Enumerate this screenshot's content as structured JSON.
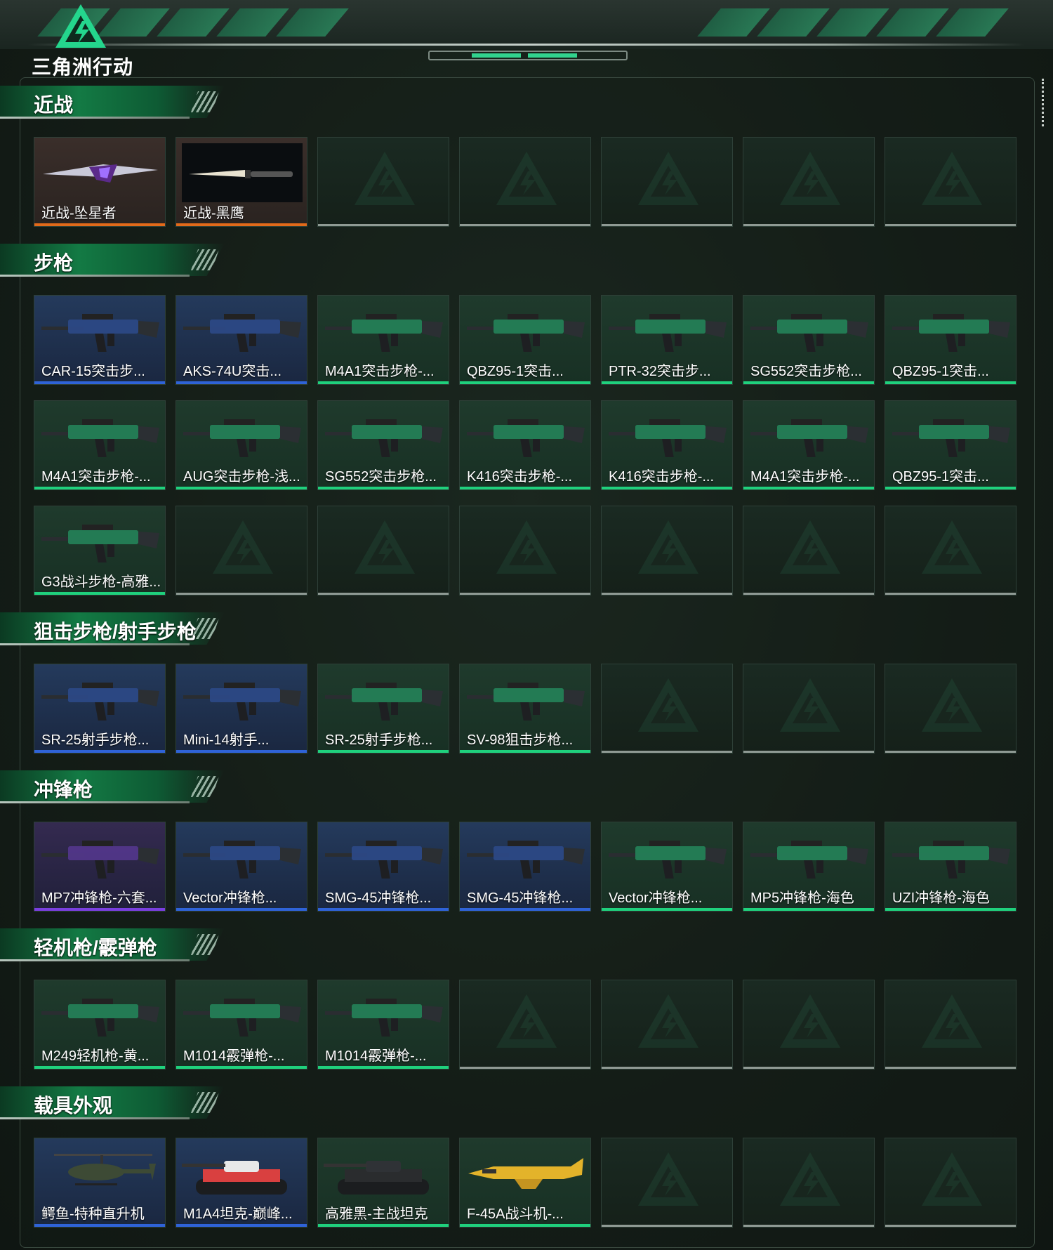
{
  "brand": {
    "name": "三角洲行动"
  },
  "colors": {
    "blue": "#2f63d8",
    "purple": "#7a3fe0",
    "orange": "#e26a1a",
    "green": "#1fd17d",
    "empty": "#8f9a94"
  },
  "sections": [
    {
      "title": "近战",
      "rows": 1,
      "items": [
        {
          "name": "近战-坠星者",
          "rarity": "orange",
          "icon": "blade-icon"
        },
        {
          "name": "近战-黑鹰",
          "rarity": "orange",
          "icon": "knife-icon"
        }
      ]
    },
    {
      "title": "步枪",
      "rows": 3,
      "items": [
        {
          "name": "CAR-15突击步...",
          "rarity": "blue",
          "icon": "rifle-icon"
        },
        {
          "name": "AKS-74U突击...",
          "rarity": "blue",
          "icon": "rifle-icon"
        },
        {
          "name": "M4A1突击步枪-...",
          "rarity": "green",
          "icon": "rifle-icon"
        },
        {
          "name": "QBZ95-1突击...",
          "rarity": "green",
          "icon": "rifle-icon"
        },
        {
          "name": "PTR-32突击步...",
          "rarity": "green",
          "icon": "rifle-icon"
        },
        {
          "name": "SG552突击步枪...",
          "rarity": "green",
          "icon": "rifle-icon"
        },
        {
          "name": "QBZ95-1突击...",
          "rarity": "green",
          "icon": "rifle-icon"
        },
        {
          "name": "M4A1突击步枪-...",
          "rarity": "green",
          "icon": "rifle-icon"
        },
        {
          "name": "AUG突击步枪-浅...",
          "rarity": "green",
          "icon": "rifle-icon"
        },
        {
          "name": "SG552突击步枪...",
          "rarity": "green",
          "icon": "rifle-icon"
        },
        {
          "name": "K416突击步枪-...",
          "rarity": "green",
          "icon": "rifle-icon"
        },
        {
          "name": "K416突击步枪-...",
          "rarity": "green",
          "icon": "rifle-icon"
        },
        {
          "name": "M4A1突击步枪-...",
          "rarity": "green",
          "icon": "rifle-icon"
        },
        {
          "name": "QBZ95-1突击...",
          "rarity": "green",
          "icon": "rifle-icon"
        },
        {
          "name": "G3战斗步枪-高雅...",
          "rarity": "green",
          "icon": "rifle-icon"
        }
      ]
    },
    {
      "title": "狙击步枪/射手步枪",
      "rows": 1,
      "items": [
        {
          "name": "SR-25射手步枪...",
          "rarity": "blue",
          "icon": "sniper-icon"
        },
        {
          "name": "Mini-14射手...",
          "rarity": "blue",
          "icon": "sniper-icon"
        },
        {
          "name": "SR-25射手步枪...",
          "rarity": "green",
          "icon": "sniper-icon"
        },
        {
          "name": "SV-98狙击步枪...",
          "rarity": "green",
          "icon": "sniper-icon"
        }
      ]
    },
    {
      "title": "冲锋枪",
      "rows": 1,
      "items": [
        {
          "name": "MP7冲锋枪-六套...",
          "rarity": "purple",
          "icon": "smg-icon"
        },
        {
          "name": "Vector冲锋枪...",
          "rarity": "blue",
          "icon": "smg-icon"
        },
        {
          "name": "SMG-45冲锋枪...",
          "rarity": "blue",
          "icon": "smg-icon"
        },
        {
          "name": "SMG-45冲锋枪...",
          "rarity": "blue",
          "icon": "smg-icon"
        },
        {
          "name": "Vector冲锋枪...",
          "rarity": "green",
          "icon": "smg-icon"
        },
        {
          "name": "MP5冲锋枪-海色",
          "rarity": "green",
          "icon": "smg-icon"
        },
        {
          "name": "UZI冲锋枪-海色",
          "rarity": "green",
          "icon": "smg-icon"
        }
      ]
    },
    {
      "title": "轻机枪/霰弹枪",
      "rows": 1,
      "items": [
        {
          "name": "M249轻机枪-黄...",
          "rarity": "green",
          "icon": "lmg-icon"
        },
        {
          "name": "M1014霰弹枪-...",
          "rarity": "green",
          "icon": "shotgun-icon"
        },
        {
          "name": "M1014霰弹枪-...",
          "rarity": "green",
          "icon": "shotgun-icon"
        }
      ]
    },
    {
      "title": "载具外观",
      "rows": 1,
      "items": [
        {
          "name": "鳄鱼-特种直升机",
          "rarity": "blue",
          "icon": "helicopter-icon"
        },
        {
          "name": "M1A4坦克-巅峰...",
          "rarity": "blue",
          "icon": "tank-icon"
        },
        {
          "name": "高雅黑-主战坦克",
          "rarity": "green",
          "icon": "tank-icon"
        },
        {
          "name": "F-45A战斗机-...",
          "rarity": "green",
          "icon": "jet-icon"
        }
      ]
    }
  ]
}
